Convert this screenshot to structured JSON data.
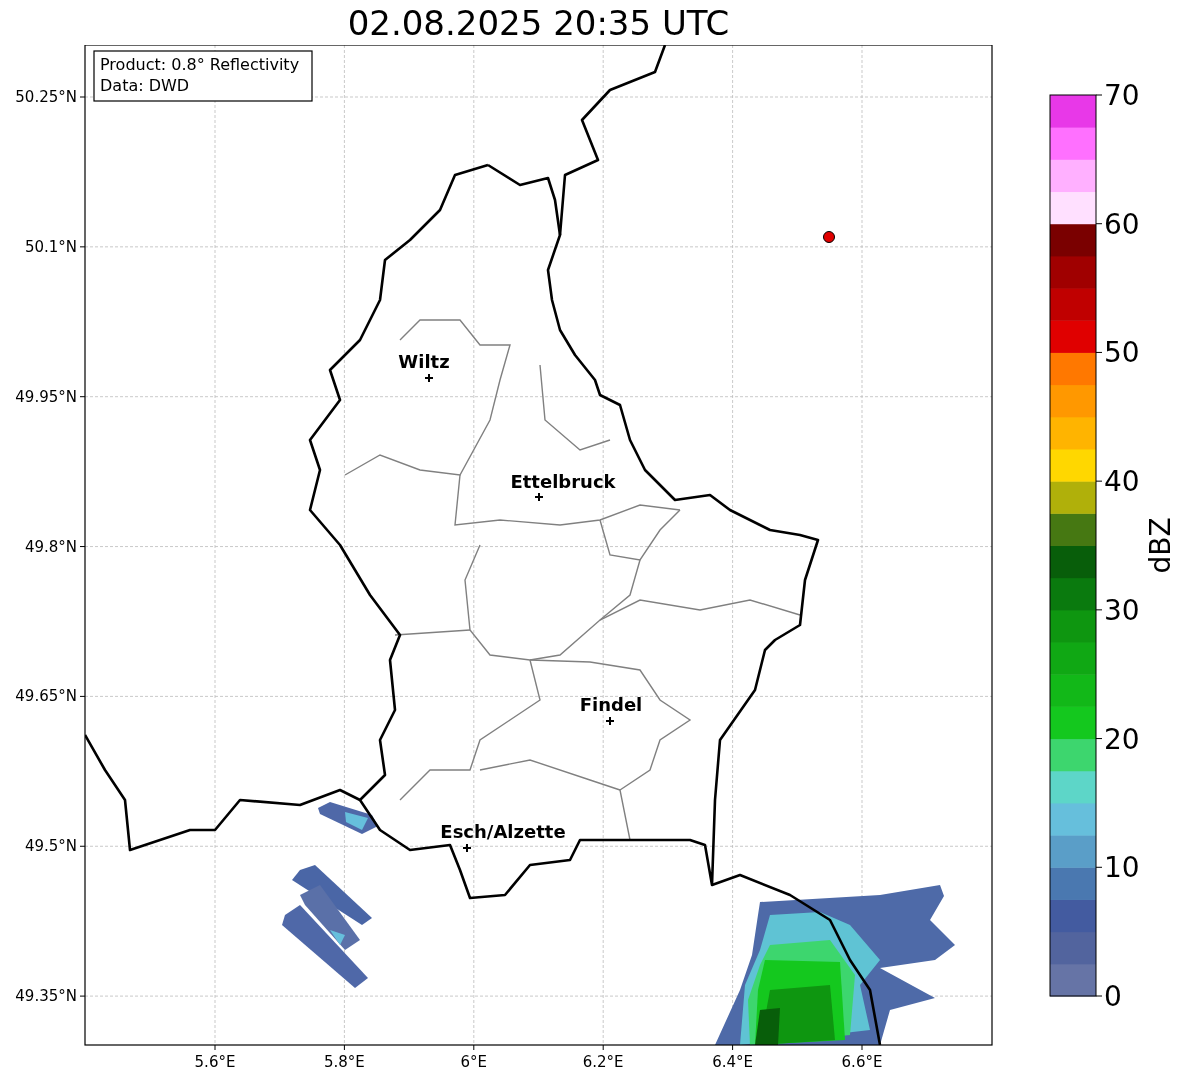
{
  "title": "02.08.2025 20:35 UTC",
  "info_box": {
    "lines": [
      "Product: 0.8° Reflectivity",
      "Data: DWD"
    ]
  },
  "map": {
    "x_ticks": [
      "5.6°E",
      "5.8°E",
      "6°E",
      "6.2°E",
      "6.4°E",
      "6.6°E"
    ],
    "y_ticks": [
      "50.25°N",
      "50.1°N",
      "49.95°N",
      "49.8°N",
      "49.65°N",
      "49.5°N",
      "49.35°N"
    ],
    "places": [
      {
        "name": "Wiltz"
      },
      {
        "name": "Ettelbruck"
      },
      {
        "name": "Findel"
      },
      {
        "name": "Esch/Alzette"
      }
    ]
  },
  "colorbar": {
    "label": "dBZ",
    "ticks": [
      "70",
      "60",
      "50",
      "40",
      "30",
      "20",
      "10",
      "0"
    ],
    "bins": [
      {
        "color": "#6674a6"
      },
      {
        "color": "#52649e"
      },
      {
        "color": "#435ba0"
      },
      {
        "color": "#4a78b0"
      },
      {
        "color": "#5a9ec8"
      },
      {
        "color": "#66bfdc"
      },
      {
        "color": "#5dd6c8"
      },
      {
        "color": "#3dd66e"
      },
      {
        "color": "#14c81e"
      },
      {
        "color": "#12b818"
      },
      {
        "color": "#10a814"
      },
      {
        "color": "#0e9610"
      },
      {
        "color": "#0a7a0e"
      },
      {
        "color": "#085e0a"
      },
      {
        "color": "#467812"
      },
      {
        "color": "#b0b00a"
      },
      {
        "color": "#ffd700"
      },
      {
        "color": "#ffb400"
      },
      {
        "color": "#ff9800"
      },
      {
        "color": "#ff7800"
      },
      {
        "color": "#e00000"
      },
      {
        "color": "#c00000"
      },
      {
        "color": "#a00000"
      },
      {
        "color": "#7a0000"
      },
      {
        "color": "#ffe0ff"
      },
      {
        "color": "#ffb0ff"
      },
      {
        "color": "#ff70ff"
      },
      {
        "color": "#e838e8"
      }
    ]
  }
}
